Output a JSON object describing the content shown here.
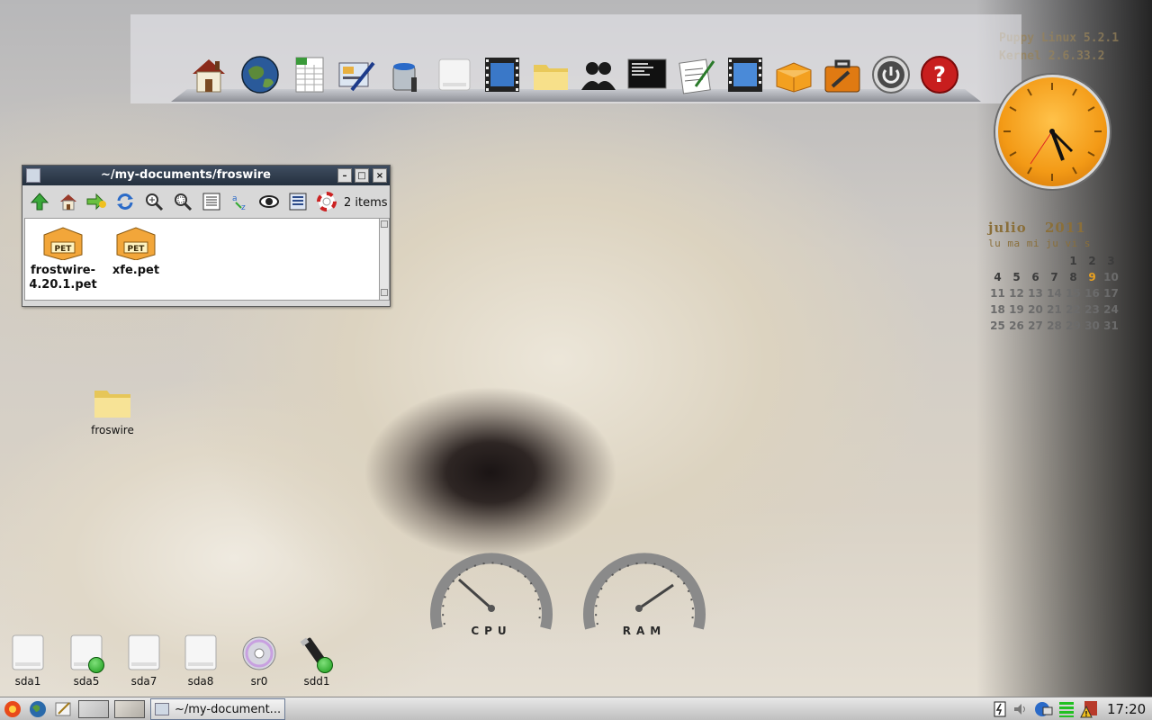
{
  "sysinfo": {
    "line1": "Puppy Linux 5.2.1",
    "line2": "Kernel 2.6.33.2"
  },
  "dock": {
    "icons": [
      "home-icon",
      "browser-globe-icon",
      "spreadsheet-icon",
      "draw-icon",
      "paint-icon",
      "drive-icon",
      "video-icon",
      "folder-icon",
      "users-icon",
      "terminal-icon",
      "text-editor-icon",
      "media-player-icon",
      "package-icon",
      "toolbox-icon",
      "power-icon",
      "help-icon"
    ]
  },
  "calendar": {
    "month": "julio",
    "year": "2011",
    "day_headers": "lu ma mi ju vi s",
    "highlight_day": 9,
    "accent_color": "#e8a020",
    "weeks": [
      [
        "",
        "",
        "",
        "",
        "1",
        "2",
        "3"
      ],
      [
        "4",
        "5",
        "6",
        "7",
        "8",
        "9",
        "10"
      ],
      [
        "11",
        "12",
        "13",
        "14",
        "15",
        "16",
        "17"
      ],
      [
        "18",
        "19",
        "20",
        "21",
        "22",
        "23",
        "24"
      ],
      [
        "25",
        "26",
        "27",
        "28",
        "29",
        "30",
        "31"
      ]
    ]
  },
  "window": {
    "title": "~/my-documents/froswire",
    "items_count": "2 items",
    "toolbar_icons": [
      "up-arrow-icon",
      "home-icon",
      "go-icon",
      "refresh-icon",
      "zoom-in-icon",
      "zoom-fit-icon",
      "list-view-icon",
      "sort-az-icon",
      "eye-icon",
      "details-view-icon",
      "help-lifebuoy-icon"
    ],
    "files": [
      {
        "name_line1": "frostwire-",
        "name_line2": "4.20.1.pet",
        "badge": "PET"
      },
      {
        "name_line1": "xfe.pet",
        "name_line2": "",
        "badge": "PET"
      }
    ]
  },
  "desktop": {
    "folder_label": "froswire",
    "drives": [
      {
        "label": "sda1",
        "mounted": false,
        "type": "drive"
      },
      {
        "label": "sda5",
        "mounted": true,
        "type": "drive"
      },
      {
        "label": "sda7",
        "mounted": false,
        "type": "drive"
      },
      {
        "label": "sda8",
        "mounted": false,
        "type": "drive"
      },
      {
        "label": "sr0",
        "mounted": false,
        "type": "cd"
      },
      {
        "label": "sdd1",
        "mounted": true,
        "type": "usb"
      }
    ]
  },
  "gauges": {
    "cpu_label": "CPU",
    "ram_label": "RAM"
  },
  "taskbar": {
    "task_label": "~/my-document...",
    "time": "17:20"
  }
}
